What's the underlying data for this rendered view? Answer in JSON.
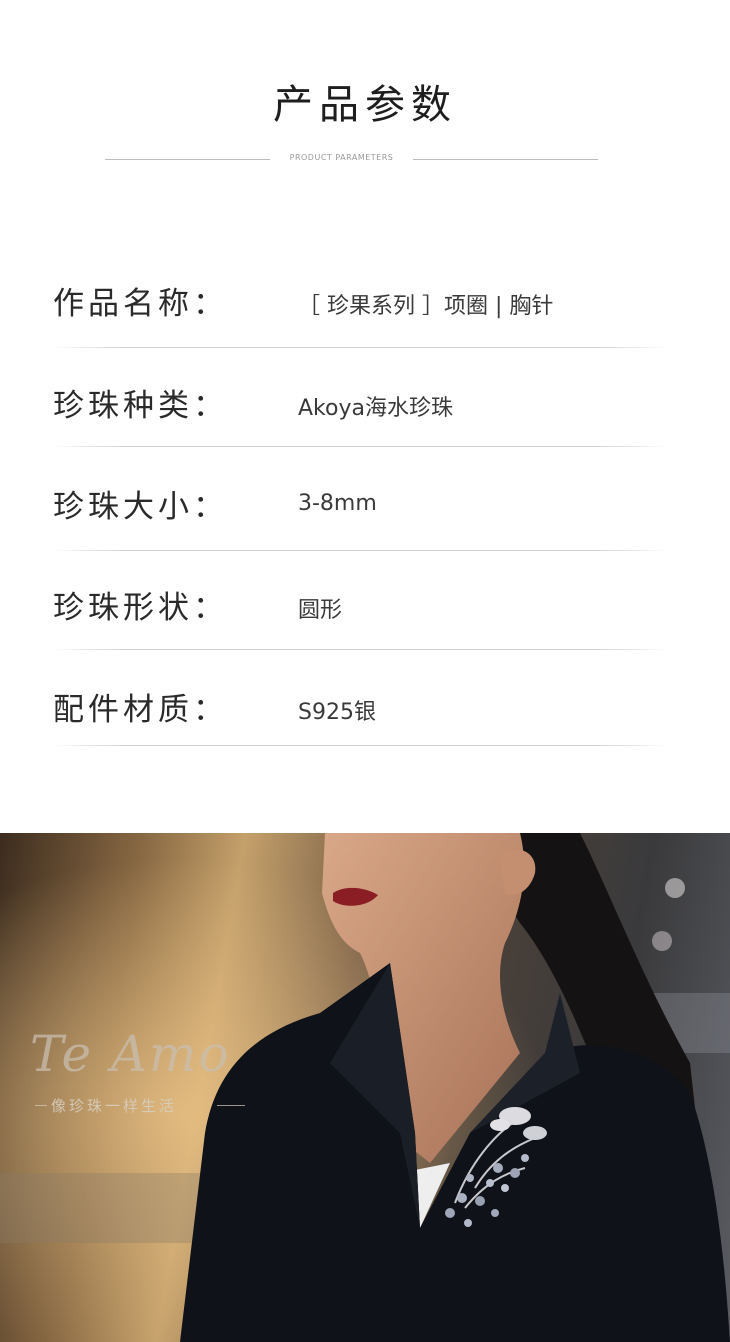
{
  "header": {
    "title": "产品参数",
    "subtitle": "PRODUCT PARAMETERS"
  },
  "params": [
    {
      "label": "作品名称：",
      "value": "［ 珍果系列 ］项圈 | 胸针"
    },
    {
      "label": "珍珠种类：",
      "value": "Akoya海水珍珠"
    },
    {
      "label": "珍珠大小：",
      "value": "3-8mm"
    },
    {
      "label": "珍珠形状：",
      "value": "圆形"
    },
    {
      "label": "配件材质：",
      "value": "S925银"
    }
  ],
  "photo": {
    "brand_logo": "Te Amo",
    "tagline": "像珍珠一样生活"
  }
}
